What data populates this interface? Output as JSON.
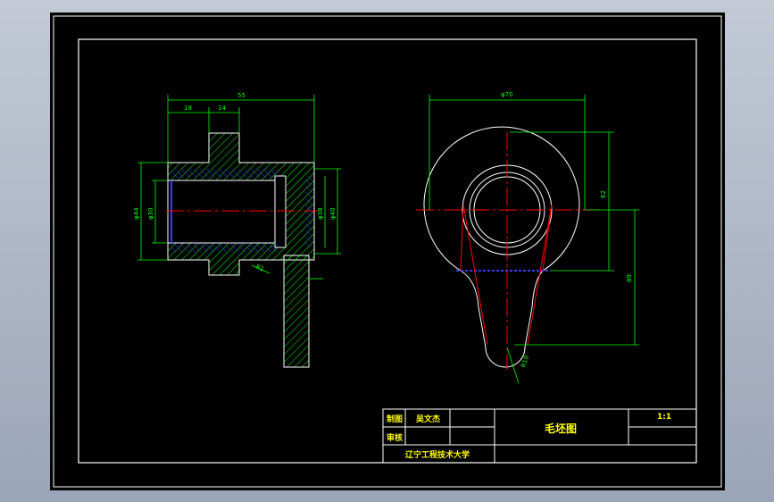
{
  "colors": {
    "sheet": "#000000",
    "frame": "#ffffff",
    "dimension": "#00ff00",
    "outline": "#ffffff",
    "center_line": "#ff0000",
    "hatch": "#00ff00",
    "hatch_blue": "#3a3aff",
    "title_text": "#ffff00"
  },
  "dimensions": {
    "d_top_total": "55",
    "d_top_left": "18",
    "d_top_mid": "14",
    "d_left_outer": "φ44",
    "d_left_inner": "φ30",
    "d_right_inner": "φ38",
    "d_right_outer": "φ40",
    "d_small_note": "R1",
    "d_circle_dia": "φ70",
    "d_right_height": "62",
    "d_right_lower": "89",
    "d_bottom_radius": "R10"
  },
  "title_block": {
    "row1_label": "制图",
    "row1_name": "吴文杰",
    "row2_label": "审核",
    "drawing_title": "毛坯图",
    "scale": "1:1",
    "school": "辽宁工程技术大学"
  }
}
